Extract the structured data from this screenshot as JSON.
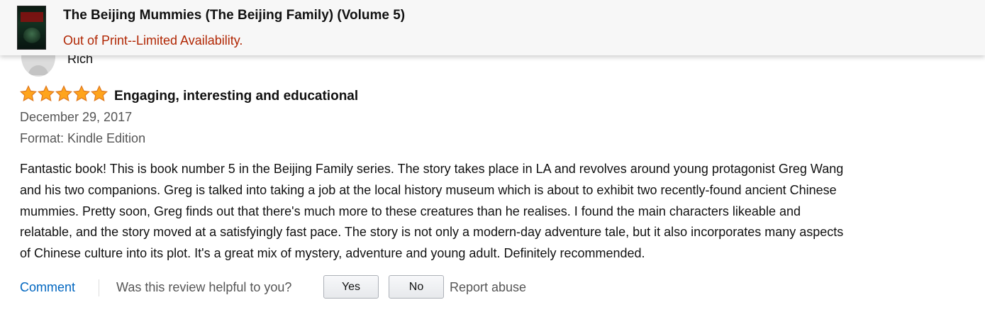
{
  "product_header": {
    "title": "The Beijing Mummies (The Beijing Family) (Volume 5)",
    "availability": "Out of Print--Limited Availability."
  },
  "review": {
    "reviewer_name": "Rich",
    "rating": 5,
    "rating_max": 5,
    "title": "Engaging, interesting and educational",
    "date": "December 29, 2017",
    "format": "Format: Kindle Edition",
    "body_lines": [
      "Fantastic book! This is book number 5 in the Beijing Family series. The story takes place in LA and revolves around young protagonist Greg Wang",
      "and his two companions. Greg is talked into taking a job at the local history museum which is about to exhibit two recently-found ancient Chinese",
      "mummies. Pretty soon, Greg finds out that there's much more to these creatures than he realises. I found the main characters likeable and",
      "relatable, and the story moved at a satisfyingly fast pace. The story is not only a modern-day adventure tale, but it also incorporates many aspects",
      "of Chinese culture into its plot. It's a great mix of mystery, adventure and young adult. Definitely recommended."
    ]
  },
  "actions": {
    "comment_label": "Comment",
    "helpful_question": "Was this review helpful to you?",
    "yes_label": "Yes",
    "no_label": "No",
    "report_label": "Report abuse"
  },
  "colors": {
    "star": "#ffa41c",
    "star_outline": "#de7921",
    "link": "#0066c0",
    "availability": "#b12704"
  },
  "icons": {
    "star": "star-icon",
    "avatar": "default-avatar-icon",
    "cover": "book-cover-thumbnail"
  }
}
